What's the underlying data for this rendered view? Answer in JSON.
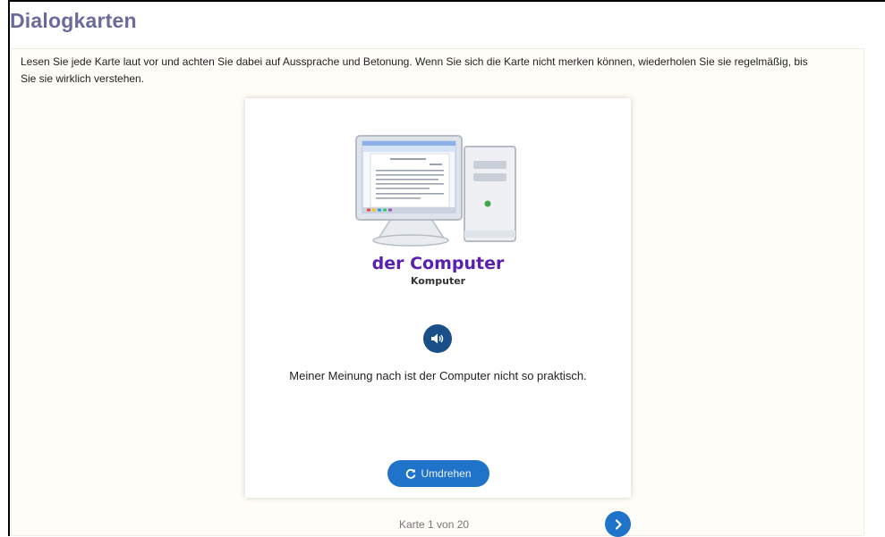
{
  "header": {
    "title": "Dialogkarten"
  },
  "instructions": "Lesen Sie jede Karte laut vor und achten Sie dabei auf Aussprache und Betonung. Wenn Sie sich die Karte nicht merken können, wiederholen Sie sie regelmäßig, bis Sie sie wirklich verstehen.",
  "card": {
    "image_icon": "desktop-computer-illustration",
    "word": "der Computer",
    "pronunciation": "Komputer",
    "audio_icon": "speaker-icon",
    "sentence": "Meiner Meinung nach ist der Computer nicht so praktisch.",
    "flip_label": "Umdrehen",
    "flip_icon": "refresh-icon"
  },
  "navigation": {
    "counter": "Karte 1 von 20",
    "next_icon": "chevron-right-icon"
  },
  "colors": {
    "title": "#6a6a9c",
    "accent": "#1f73c9",
    "audio_button": "#1a4f8a",
    "word": "#5a1fb0"
  }
}
